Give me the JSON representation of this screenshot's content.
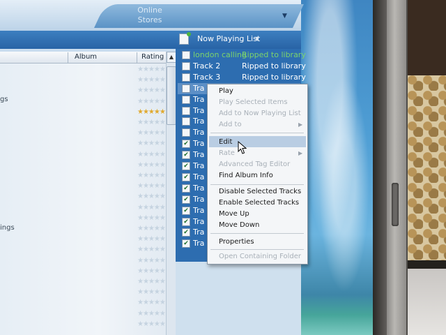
{
  "top_bar": {
    "online_stores_line1": "Online",
    "online_stores_line2": "Stores"
  },
  "toolbar": {
    "now_playing_label": "Now Playing List"
  },
  "library": {
    "columns": {
      "album": "Album",
      "rating": "Rating"
    },
    "visible_fragments": [
      "gs",
      "ings"
    ]
  },
  "now_playing": {
    "rows": [
      {
        "title": "london calling",
        "status": "Ripped to library",
        "checked": false,
        "green": true
      },
      {
        "title": "Track 2",
        "status": "Ripped to library",
        "checked": false,
        "green": false
      },
      {
        "title": "Track 3",
        "status": "Ripped to library",
        "checked": false,
        "green": false
      },
      {
        "title": "Tra",
        "status": "",
        "checked": false,
        "green": false
      },
      {
        "title": "Tra",
        "status": "",
        "checked": false,
        "green": false
      },
      {
        "title": "Tra",
        "status": "",
        "checked": false,
        "green": false
      },
      {
        "title": "Tra",
        "status": "",
        "checked": false,
        "green": false
      },
      {
        "title": "Tra",
        "status": "",
        "checked": false,
        "green": false
      },
      {
        "title": "Tra",
        "status": "",
        "checked": true,
        "green": false
      },
      {
        "title": "Tra",
        "status": "",
        "checked": true,
        "green": false
      },
      {
        "title": "Tra",
        "status": "",
        "checked": true,
        "green": false
      },
      {
        "title": "Tra",
        "status": "",
        "checked": true,
        "green": false
      },
      {
        "title": "Tra",
        "status": "",
        "checked": true,
        "green": false
      },
      {
        "title": "Tra",
        "status": "",
        "checked": true,
        "green": false
      },
      {
        "title": "Tra",
        "status": "",
        "checked": true,
        "green": false
      },
      {
        "title": "Tra",
        "status": "",
        "checked": true,
        "green": false
      },
      {
        "title": "Tra",
        "status": "",
        "checked": true,
        "green": false
      },
      {
        "title": "Tra",
        "status": "",
        "checked": true,
        "green": false
      }
    ]
  },
  "context_menu": {
    "play": "Play",
    "play_selected": "Play Selected Items",
    "add_to_now_playing": "Add to Now Playing List",
    "add_to": "Add to",
    "edit": "Edit",
    "rate": "Rate",
    "advanced_tag_editor": "Advanced Tag Editor",
    "find_album_info": "Find Album Info",
    "disable_selected": "Disable Selected Tracks",
    "enable_selected": "Enable Selected Tracks",
    "move_up": "Move Up",
    "move_down": "Move Down",
    "properties": "Properties",
    "open_containing_folder": "Open Containing Folder"
  },
  "icons": {
    "submenu_arrow": "chevron-right-icon",
    "check": "checkmark-icon",
    "cursor": "mouse-pointer-icon"
  },
  "colors": {
    "selection_blue": "#2d6db0",
    "ripped_green": "#7dd36b",
    "star_gold": "#e0a92e"
  }
}
